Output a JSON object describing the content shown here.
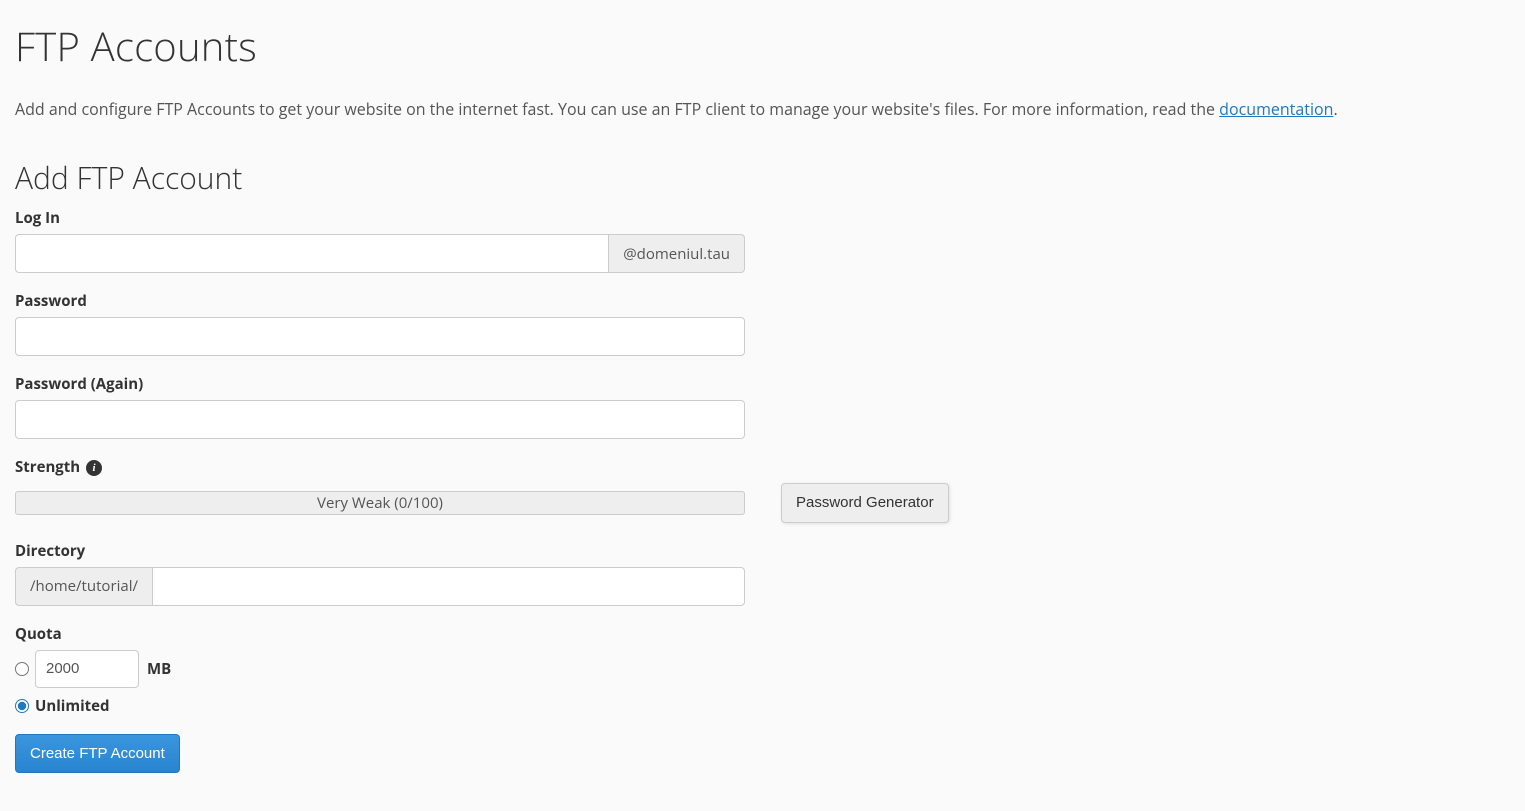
{
  "page": {
    "title": "FTP Accounts",
    "intro_prefix": "Add and configure FTP Accounts to get your website on the internet fast. You can use an FTP client to manage your website's files. For more information, read the ",
    "intro_link": "documentation",
    "intro_suffix": "."
  },
  "form": {
    "heading": "Add FTP Account",
    "login": {
      "label": "Log In",
      "value": "",
      "domain_suffix": "@domeniul.tau"
    },
    "password": {
      "label": "Password",
      "value": ""
    },
    "password_again": {
      "label": "Password (Again)",
      "value": ""
    },
    "strength": {
      "label": "Strength",
      "text": "Very Weak (0/100)",
      "generator_button": "Password Generator"
    },
    "directory": {
      "label": "Directory",
      "prefix": "/home/tutorial/",
      "value": ""
    },
    "quota": {
      "label": "Quota",
      "value": "2000",
      "unit": "MB",
      "unlimited_label": "Unlimited",
      "selected": "unlimited"
    },
    "submit": "Create FTP Account"
  }
}
